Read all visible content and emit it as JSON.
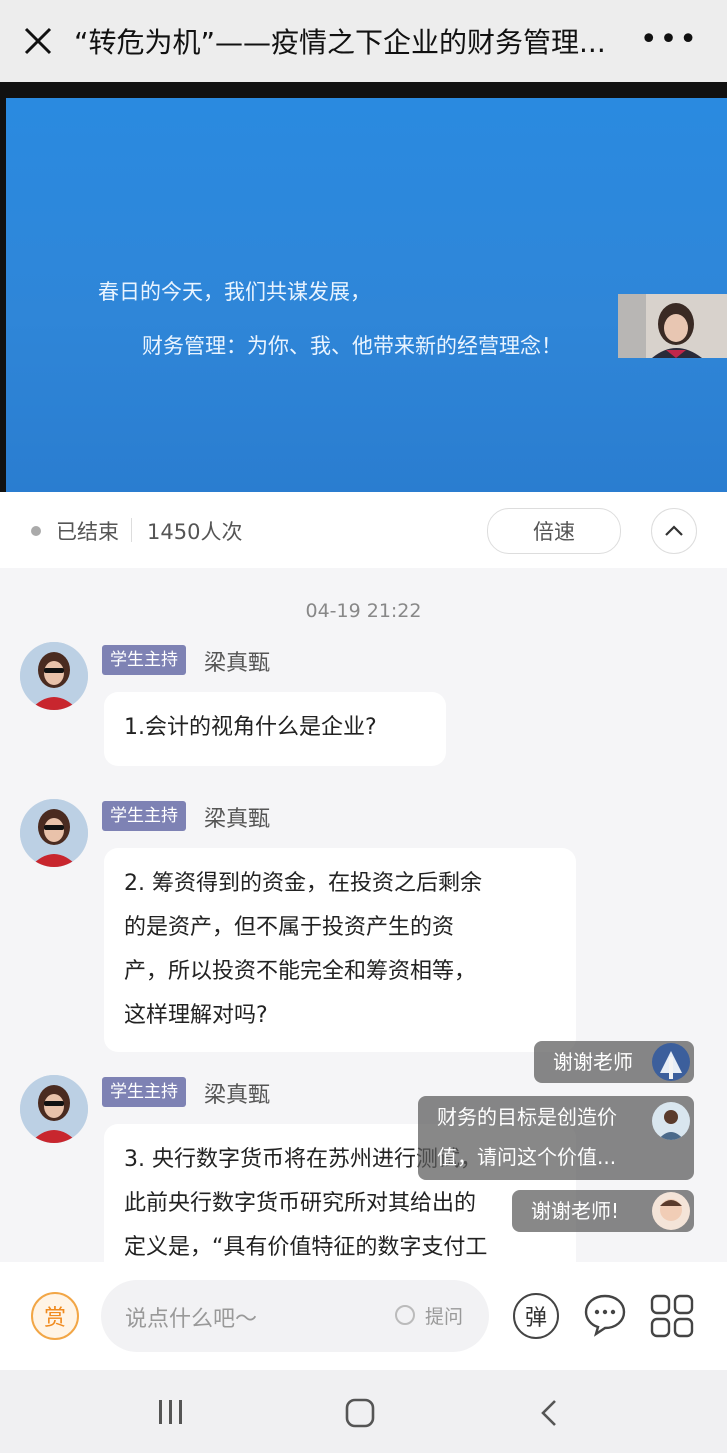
{
  "header": {
    "title": "“转危为机”——疫情之下企业的财务管理..."
  },
  "video": {
    "line1": "春日的今天，我们共谋发展，",
    "line2": "财务管理：为你、我、他带来新的经营理念！"
  },
  "status": {
    "state": "已结束",
    "views": "1450人次",
    "speed_label": "倍速"
  },
  "chat": {
    "timestamp": "04-19 21:22",
    "messages": [
      {
        "badge": "学生主持",
        "name": "梁真甄",
        "lines": [
          "1.会计的视角什么是企业?"
        ]
      },
      {
        "badge": "学生主持",
        "name": "梁真甄",
        "lines": [
          "2. 筹资得到的资金，在投资之后剩余",
          "的是资产，但不属于投资产生的资",
          "产，所以投资不能完全和筹资相等，",
          "这样理解对吗?"
        ]
      },
      {
        "badge": "学生主持",
        "name": "梁真甄",
        "lines": [
          "3. 央行数字货币将在苏州进行测试，",
          "此前央行数字货币研究所对其给出的",
          "定义是，“具有价值特征的数字支付工"
        ]
      }
    ]
  },
  "danmaku": [
    {
      "text": "谢谢老师"
    },
    {
      "line1": "财务的目标是创造价",
      "line2": "值，请问这个价值..."
    },
    {
      "text": "谢谢老师!"
    }
  ],
  "input": {
    "reward_label": "赏",
    "placeholder": "说点什么吧〜",
    "ask_label": "提问",
    "danmu_label": "弹"
  },
  "colors": {
    "slide_blue": "#2f86d8",
    "badge": "#7e82b4",
    "reward_orange": "#f08a1e"
  }
}
